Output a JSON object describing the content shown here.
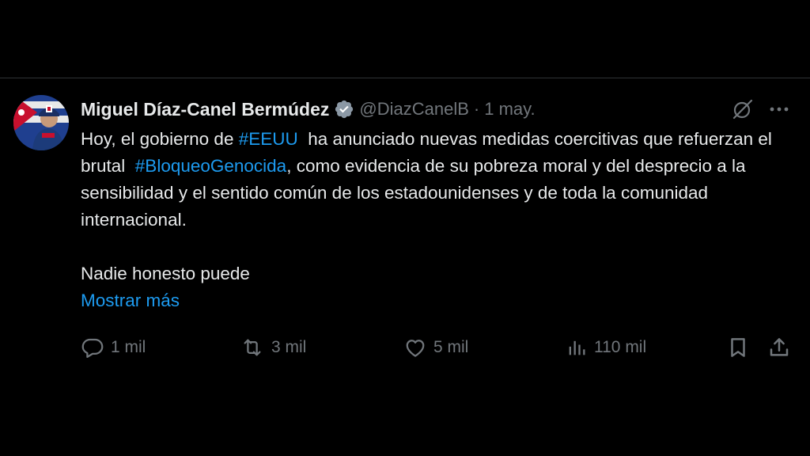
{
  "tweet": {
    "author": {
      "name": "Miguel Díaz-Canel Bermúdez",
      "handle": "@DiazCanelB",
      "verified": true
    },
    "separator": "·",
    "date": "1 may.",
    "text": {
      "line_parts": {
        "p1a": "Hoy, el gobierno de ",
        "hashtag1": "#EEUU",
        "p1b": "  ha anunciado nuevas medidas coercitivas que refuerzan el brutal  ",
        "hashtag2": "#BloqueoGenocida",
        "p1c": ", como evidencia de su pobreza moral y del desprecio a la sensibilidad y el sentido común de los estadounidenses y de toda la comunidad internacional."
      },
      "paragraph2": "Nadie honesto puede",
      "show_more": "Mostrar más"
    },
    "actions": {
      "replies": "1 mil",
      "reposts": "3 mil",
      "likes": "5 mil",
      "views": "110 mil"
    },
    "colors": {
      "link": "#1d9bf0",
      "muted": "#71767b",
      "text": "#e7e9ea",
      "background": "#000000",
      "divider": "#2f3336"
    },
    "icons": [
      "verified-badge-icon",
      "grok-icon",
      "more-icon",
      "reply-icon",
      "repost-icon",
      "like-icon",
      "views-icon",
      "bookmark-icon",
      "share-icon"
    ]
  }
}
